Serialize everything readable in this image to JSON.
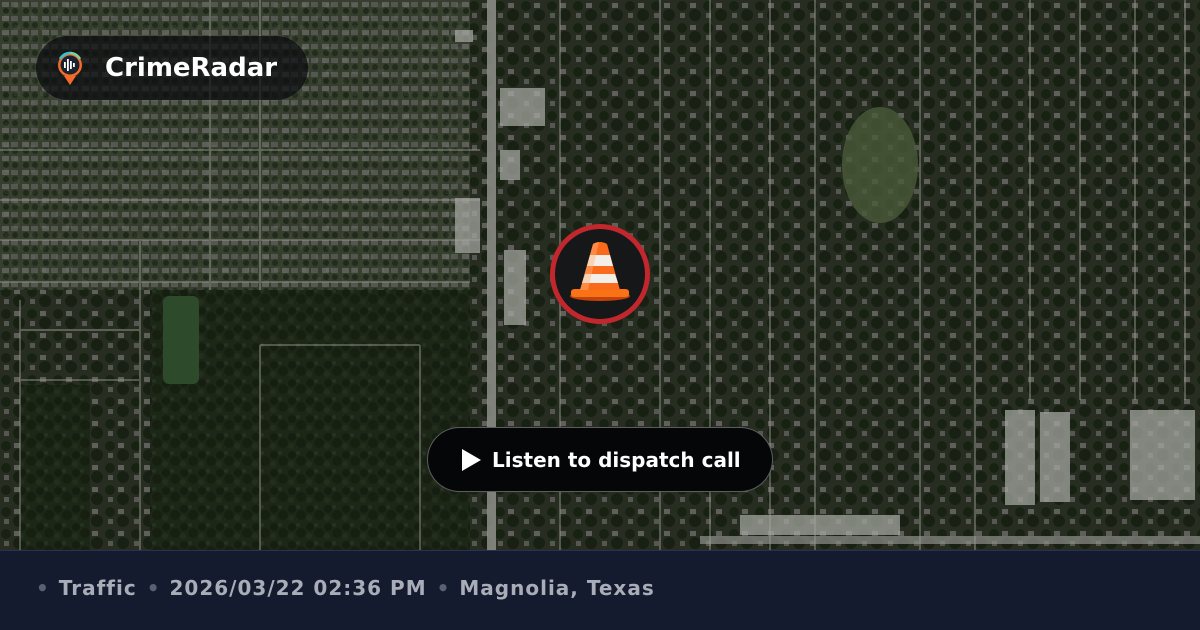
{
  "brand": {
    "name": "CrimeRadar",
    "logo_icon": "radar-pin-logo-icon",
    "accent": "#f26b2a"
  },
  "marker": {
    "icon": "traffic-cone-icon",
    "ring_color": "#c1272d"
  },
  "action": {
    "label": "Listen to dispatch call",
    "icon": "play-icon"
  },
  "incident": {
    "separator": "•",
    "category": "Traffic",
    "datetime": "2026/03/22 02:36 PM",
    "location": "Magnolia, Texas"
  },
  "colors": {
    "footer_bg": "#151b2f",
    "footer_text": "#a9adb8"
  }
}
